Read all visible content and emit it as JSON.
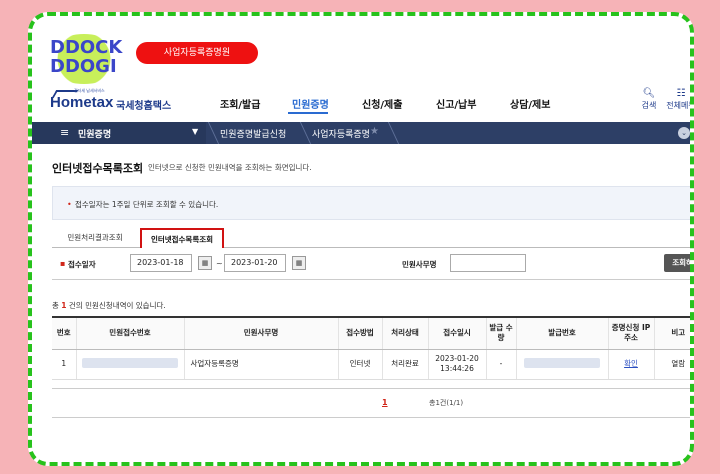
{
  "sticker": {
    "line1": "DDOCK",
    "line2": "DDOGI"
  },
  "pill": {
    "label": "사업자등록증명원"
  },
  "header": {
    "logo_small": "전자세 납세서비스",
    "logo_text": "Hometax",
    "logo_kr": "국세청홈택스",
    "nav": [
      "조회/발급",
      "민원증명",
      "신청/제출",
      "신고/납부",
      "상담/제보"
    ],
    "active_nav": 1,
    "search_label": "검색",
    "allmenu_label": "전체메뉴"
  },
  "breadcrumb": {
    "home": "민원증명",
    "crumbs": [
      "민원증명발급신청",
      "사업자등록증명"
    ]
  },
  "page": {
    "title": "인터넷접수목록조회",
    "subtitle": "인터넷으로 신청한 민원내역을 조회하는 화면입니다.",
    "notice": "접수일자는 1주일 단위로 조회할 수 있습니다."
  },
  "tabs": [
    "민원처리결과조회",
    "인터넷접수목록조회"
  ],
  "search": {
    "date_label": "접수일자",
    "date_from": "2023-01-18",
    "date_to": "2023-01-20",
    "tilde": "~",
    "office_label": "민원사무명",
    "office_value": "",
    "button": "조회하기"
  },
  "count": {
    "prefix": "총",
    "n": "1",
    "suffix": "건의 민원신청내역이 있습니다."
  },
  "table": {
    "headers": [
      "번호",
      "민원접수번호",
      "민원사무명",
      "접수방법",
      "처리상태",
      "접수일시",
      "발급 수량",
      "발급번호",
      "증명신청 IP주소",
      "비고"
    ],
    "rows": [
      {
        "no": "1",
        "office": "사업자등록증명",
        "method": "인터넷",
        "status": "처리완료",
        "date": "2023-01-20",
        "time": "13:44:26",
        "qty": "-",
        "ip": "확인",
        "note": "열람"
      }
    ]
  },
  "pager": {
    "page": "1",
    "count": "총1건(1/1)"
  },
  "colors": {
    "frame": "#27c21c",
    "bg": "#f6b3b7",
    "bar": "#2d3f66",
    "accent": "#2a6bd1",
    "red": "#d11212"
  }
}
